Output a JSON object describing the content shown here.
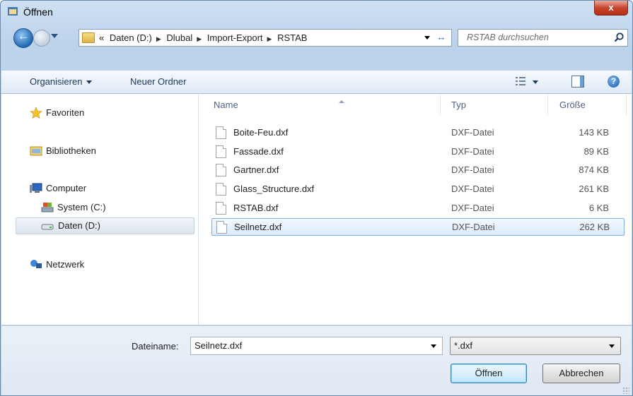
{
  "window": {
    "title": "Öffnen",
    "close_label": "x"
  },
  "address": {
    "overflow": "«",
    "crumbs": [
      "Daten (D:)",
      "Dlubal",
      "Import-Export",
      "RSTAB"
    ],
    "separator": "▶"
  },
  "search": {
    "placeholder": "RSTAB durchsuchen"
  },
  "toolbar": {
    "organize": "Organisieren",
    "new_folder": "Neuer Ordner"
  },
  "nav": {
    "favorites": "Favoriten",
    "libraries": "Bibliotheken",
    "computer": "Computer",
    "system_c": "System (C:)",
    "data_d": "Daten (D:)",
    "network": "Netzwerk"
  },
  "columns": {
    "name": "Name",
    "type": "Typ",
    "size": "Größe"
  },
  "files": [
    {
      "name": "Boite-Feu.dxf",
      "type": "DXF-Datei",
      "size": "143 KB"
    },
    {
      "name": "Fassade.dxf",
      "type": "DXF-Datei",
      "size": "89 KB"
    },
    {
      "name": "Gartner.dxf",
      "type": "DXF-Datei",
      "size": "874 KB"
    },
    {
      "name": "Glass_Structure.dxf",
      "type": "DXF-Datei",
      "size": "261 KB"
    },
    {
      "name": "RSTAB.dxf",
      "type": "DXF-Datei",
      "size": "6 KB"
    },
    {
      "name": "Seilnetz.dxf",
      "type": "DXF-Datei",
      "size": "262 KB"
    }
  ],
  "selected_file_index": 5,
  "filename": {
    "label": "Dateiname:",
    "value": "Seilnetz.dxf"
  },
  "filter": {
    "value": "*.dxf"
  },
  "buttons": {
    "open": "Öffnen",
    "cancel": "Abbrechen"
  },
  "colors": {
    "accent": "#3c7fb1",
    "selection": "#dcebfb",
    "close": "#c7452c"
  },
  "icons": [
    "app-icon",
    "back-arrow-icon",
    "forward-arrow-icon",
    "folder-icon",
    "refresh-icon",
    "search-icon",
    "views-icon",
    "preview-pane-icon",
    "help-icon",
    "star-icon",
    "library-icon",
    "computer-icon",
    "drive-icon",
    "network-icon",
    "file-icon"
  ]
}
